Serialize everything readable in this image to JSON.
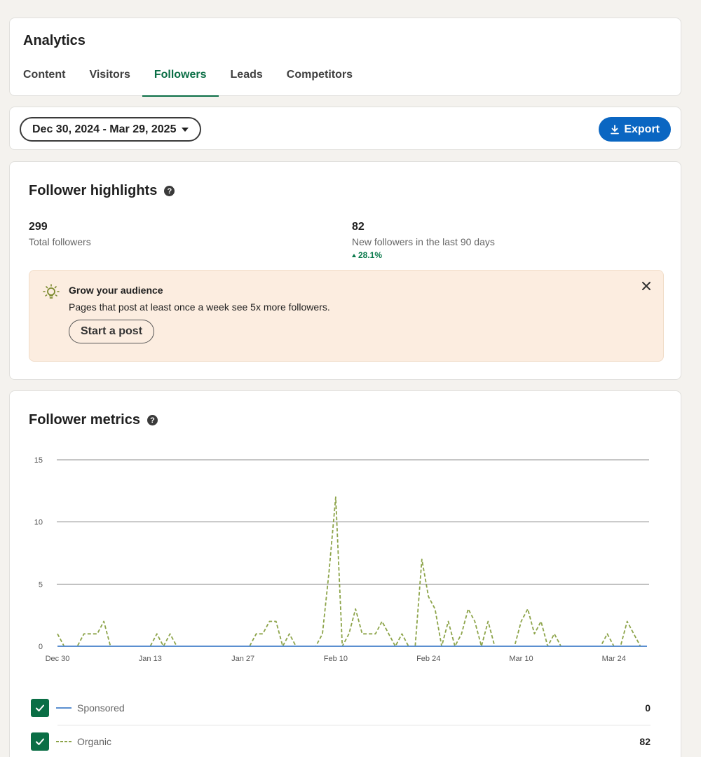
{
  "header": {
    "title": "Analytics",
    "tabs": [
      {
        "label": "Content"
      },
      {
        "label": "Visitors"
      },
      {
        "label": "Followers"
      },
      {
        "label": "Leads"
      },
      {
        "label": "Competitors"
      }
    ],
    "active_tab": "Followers"
  },
  "toolbar": {
    "date_range": "Dec 30, 2024 - Mar 29, 2025",
    "export_label": "Export"
  },
  "highlights": {
    "title": "Follower highlights",
    "total_value": "299",
    "total_label": "Total followers",
    "new_value": "82",
    "new_label": "New followers in the last 90 days",
    "new_trend": "28.1%",
    "promo": {
      "title": "Grow your audience",
      "text": "Pages that post at least once a week see 5x more followers.",
      "button_label": "Start a post"
    }
  },
  "metrics": {
    "title": "Follower metrics",
    "legend": [
      {
        "label": "Sponsored",
        "value": "0",
        "checked": true
      },
      {
        "label": "Organic",
        "value": "82",
        "checked": true
      }
    ]
  },
  "colors": {
    "accent_green": "#0a6e45",
    "link_blue": "#0a66c2",
    "sponsored": "#5b8fd0",
    "organic": "#8da44a",
    "promo_bg": "#fcede0"
  },
  "chart_data": {
    "type": "line",
    "x_start": "2024-12-30",
    "x_ticks": [
      "Dec 30",
      "Jan 13",
      "Jan 27",
      "Feb 10",
      "Feb 24",
      "Mar 10",
      "Mar 24"
    ],
    "y_ticks": [
      0,
      5,
      10,
      15
    ],
    "ylim": [
      0,
      15
    ],
    "grid": true,
    "series": [
      {
        "name": "Sponsored",
        "style": "solid",
        "values": [
          0,
          0,
          0,
          0,
          0,
          0,
          0,
          0,
          0,
          0,
          0,
          0,
          0,
          0,
          0,
          0,
          0,
          0,
          0,
          0,
          0,
          0,
          0,
          0,
          0,
          0,
          0,
          0,
          0,
          0,
          0,
          0,
          0,
          0,
          0,
          0,
          0,
          0,
          0,
          0,
          0,
          0,
          0,
          0,
          0,
          0,
          0,
          0,
          0,
          0,
          0,
          0,
          0,
          0,
          0,
          0,
          0,
          0,
          0,
          0,
          0,
          0,
          0,
          0,
          0,
          0,
          0,
          0,
          0,
          0,
          0,
          0,
          0,
          0,
          0,
          0,
          0,
          0,
          0,
          0,
          0,
          0,
          0,
          0,
          0,
          0,
          0,
          0,
          0,
          0
        ]
      },
      {
        "name": "Organic",
        "style": "dashed",
        "values": [
          1,
          0,
          0,
          0,
          1,
          1,
          1,
          2,
          0,
          0,
          0,
          0,
          0,
          0,
          0,
          1,
          0,
          1,
          0,
          0,
          0,
          0,
          0,
          0,
          0,
          0,
          0,
          0,
          0,
          0,
          1,
          1,
          2,
          2,
          0,
          1,
          0,
          0,
          0,
          0,
          1,
          6,
          12,
          0,
          1,
          3,
          1,
          1,
          1,
          2,
          1,
          0,
          1,
          0,
          0,
          7,
          4,
          3,
          0,
          2,
          0,
          1,
          3,
          2,
          0,
          2,
          0,
          0,
          0,
          0,
          2,
          3,
          1,
          2,
          0,
          1,
          0,
          0,
          0,
          0,
          0,
          0,
          0,
          1,
          0,
          0,
          2,
          1,
          0,
          0
        ]
      }
    ]
  }
}
